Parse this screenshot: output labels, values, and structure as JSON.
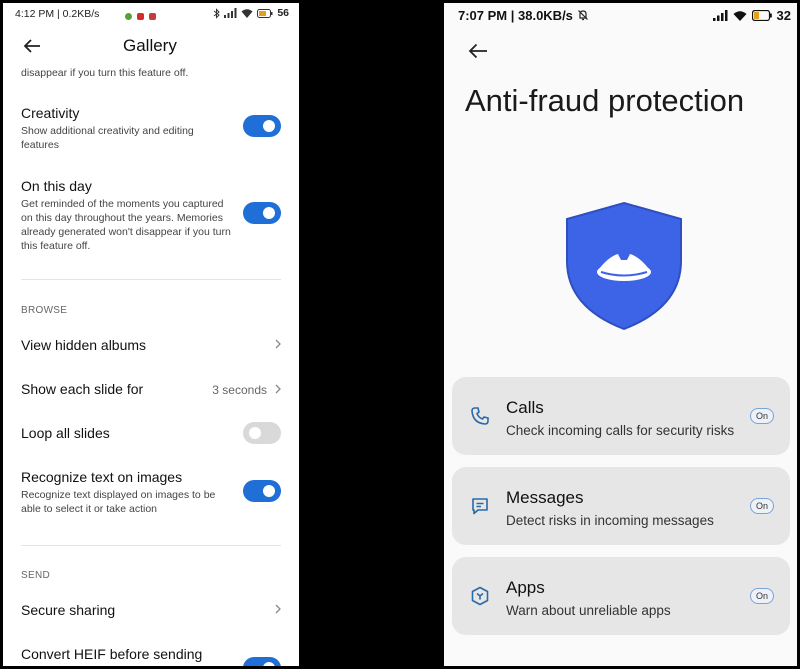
{
  "left": {
    "status": {
      "time": "4:12 PM | 0.2KB/s",
      "battery": "56"
    },
    "title": "Gallery",
    "clipped_text": "disappear if you turn this feature off.",
    "creativity": {
      "title": "Creativity",
      "desc": "Show additional creativity and editing features",
      "on": true
    },
    "on_this_day": {
      "title": "On this day",
      "desc": "Get reminded of the moments you captured on this day throughout the years. Memories already generated won't disappear if you turn this feature off.",
      "on": true
    },
    "browse_header": "BROWSE",
    "view_hidden": {
      "title": "View hidden albums"
    },
    "slide": {
      "title": "Show each slide for",
      "value": "3 seconds"
    },
    "loop": {
      "title": "Loop all slides",
      "on": false
    },
    "recognize": {
      "title": "Recognize text on images",
      "desc": "Recognize text displayed on images to be able to select it or take action",
      "on": true
    },
    "send_header": "SEND",
    "secure": {
      "title": "Secure sharing"
    },
    "heif": {
      "title": "Convert HEIF before sending"
    }
  },
  "right": {
    "status": {
      "time": "7:07 PM | 38.0KB/s",
      "battery": "32"
    },
    "title": "Anti-fraud protection",
    "cards": [
      {
        "icon": "phone-icon",
        "title": "Calls",
        "desc": "Check incoming calls for security risks",
        "state": "On"
      },
      {
        "icon": "message-icon",
        "title": "Messages",
        "desc": "Detect risks in incoming messages",
        "state": "On"
      },
      {
        "icon": "apps-shield-icon",
        "title": "Apps",
        "desc": "Warn about unreliable apps",
        "state": "On"
      }
    ],
    "colors": {
      "accent": "#3d63e6",
      "toggle_on": "#1f6fd6"
    }
  }
}
